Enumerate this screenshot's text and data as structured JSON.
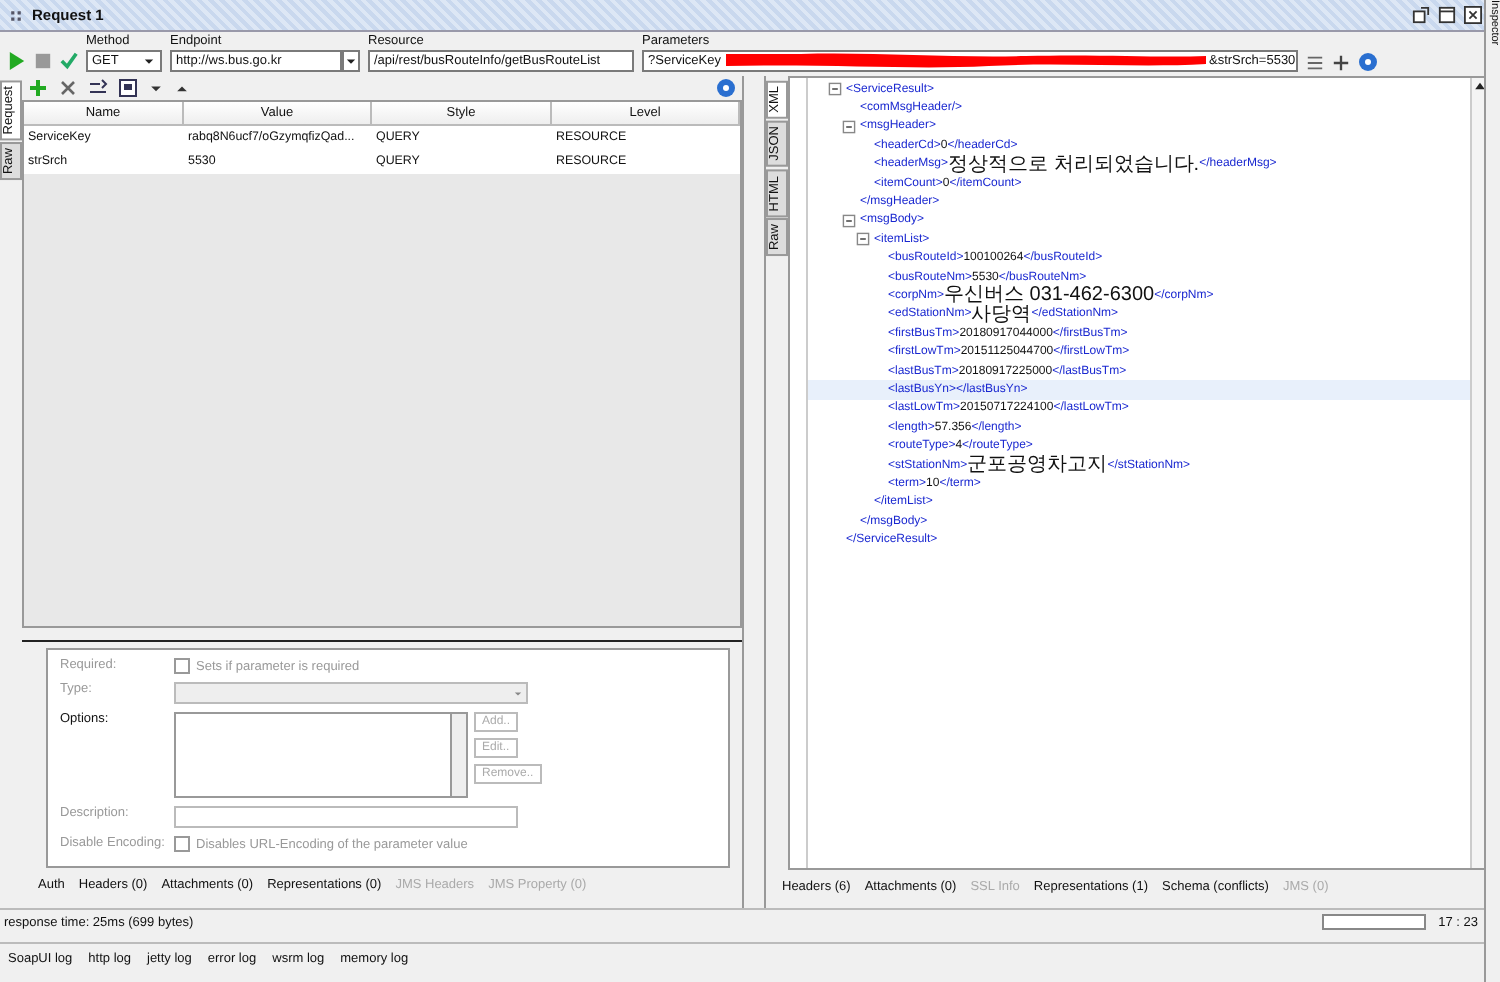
{
  "window": {
    "title": "Request 1"
  },
  "toolbar": {
    "method": {
      "label": "Method",
      "value": "GET"
    },
    "endpoint": {
      "label": "Endpoint",
      "value": "http://ws.bus.go.kr"
    },
    "resource": {
      "label": "Resource",
      "value": "/api/rest/busRouteInfo/getBusRouteList"
    },
    "parameters": {
      "label": "Parameters",
      "value_start": "?ServiceKey",
      "value_end": "&strSrch=5530"
    }
  },
  "request_tabs": [
    {
      "label": "Request",
      "selected": true
    },
    {
      "label": "Raw",
      "selected": false
    }
  ],
  "params_table": {
    "columns": [
      "Name",
      "Value",
      "Style",
      "Level"
    ],
    "rows": [
      [
        "ServiceKey",
        "rabq8N6ucf7/oGzymqfizQad...",
        "QUERY",
        "RESOURCE"
      ],
      [
        "strSrch",
        "5530",
        "QUERY",
        "RESOURCE"
      ]
    ]
  },
  "param_form": [
    {
      "kind": "checkbox",
      "label": "Required:",
      "text": "Sets if parameter is required",
      "checked": false,
      "disabled": true
    },
    {
      "kind": "select",
      "label": "Type:",
      "disabled": true
    },
    {
      "kind": "list",
      "label": "Options:",
      "disabled": false,
      "buttons": [
        "Add..",
        "Edit..",
        "Remove.."
      ]
    },
    {
      "kind": "text",
      "label": "Description:",
      "disabled": true
    },
    {
      "kind": "checkbox",
      "label": "Disable Encoding:",
      "text": "Disables URL-Encoding of the parameter value",
      "checked": false,
      "disabled": true
    }
  ],
  "request_bottom_tabs": [
    {
      "label": "Auth",
      "disabled": false
    },
    {
      "label": "Headers (0)",
      "disabled": false
    },
    {
      "label": "Attachments (0)",
      "disabled": false
    },
    {
      "label": "Representations (0)",
      "disabled": false
    },
    {
      "label": "JMS Headers",
      "disabled": true
    },
    {
      "label": "JMS Property (0)",
      "disabled": true
    }
  ],
  "response_tabs": [
    {
      "label": "XML",
      "selected": true
    },
    {
      "label": "JSON",
      "selected": false
    },
    {
      "label": "HTML",
      "selected": false
    },
    {
      "label": "Raw",
      "selected": false
    }
  ],
  "xml": {
    "open": "<ServiceResult>",
    "close": "</ServiceResult>",
    "selected": false,
    "children": [
      {
        "empty": "<comMsgHeader/>",
        "selected": false
      },
      {
        "open": "<msgHeader>",
        "close": "</msgHeader>",
        "selected": false,
        "children": [
          {
            "start": "<headerCd>",
            "value": "0",
            "end": "</headerCd>",
            "selected": false
          },
          {
            "start": "<headerMsg>",
            "value": "정상적으로 처리되었습니다.",
            "end": "</headerMsg>",
            "selected": false
          },
          {
            "start": "<itemCount>",
            "value": "0",
            "end": "</itemCount>",
            "selected": false
          }
        ]
      },
      {
        "open": "<msgBody>",
        "close": "</msgBody>",
        "selected": false,
        "children": [
          {
            "open": "<itemList>",
            "close": "</itemList>",
            "selected": false,
            "children": [
              {
                "start": "<busRouteId>",
                "value": "100100264",
                "end": "</busRouteId>",
                "selected": false
              },
              {
                "start": "<busRouteNm>",
                "value": "5530",
                "end": "</busRouteNm>",
                "selected": false
              },
              {
                "start": "<corpNm>",
                "value": "우신버스 031-462-6300",
                "end": "</corpNm>",
                "selected": false
              },
              {
                "start": "<edStationNm>",
                "value": "사당역",
                "end": "</edStationNm>",
                "selected": false
              },
              {
                "start": "<firstBusTm>",
                "value": "20180917044000",
                "end": "</firstBusTm>",
                "selected": false
              },
              {
                "start": "<firstLowTm>",
                "value": "20151125044700",
                "end": "</firstLowTm>",
                "selected": false
              },
              {
                "start": "<lastBusTm>",
                "value": "20180917225000",
                "end": "</lastBusTm>",
                "selected": false
              },
              {
                "start": "<lastBusYn>",
                "end": "</lastBusYn>",
                "selected": true
              },
              {
                "start": "<lastLowTm>",
                "value": "20150717224100",
                "end": "</lastLowTm>",
                "selected": false
              },
              {
                "start": "<length>",
                "value": "57.356",
                "end": "</length>",
                "selected": false
              },
              {
                "start": "<routeType>",
                "value": "4",
                "end": "</routeType>",
                "selected": false
              },
              {
                "start": "<stStationNm>",
                "value": "군포공영차고지",
                "end": "</stStationNm>",
                "selected": false
              },
              {
                "start": "<term>",
                "value": "10",
                "end": "</term>",
                "selected": false
              }
            ]
          }
        ]
      }
    ]
  },
  "response_bottom_tabs": [
    {
      "label": "Headers (6)",
      "disabled": false
    },
    {
      "label": "Attachments (0)",
      "disabled": false
    },
    {
      "label": "SSL Info",
      "disabled": true
    },
    {
      "label": "Representations (1)",
      "disabled": false
    },
    {
      "label": "Schema (conflicts)",
      "disabled": false
    },
    {
      "label": "JMS (0)",
      "disabled": true
    }
  ],
  "status": {
    "response_time": "response time: 25ms (699 bytes)",
    "progress": {
      "level": 0
    },
    "cursor": "17 : 23"
  },
  "log_tabs": [
    "SoapUI log",
    "http log",
    "jetty log",
    "error log",
    "wsrm log",
    "memory log"
  ],
  "side_panel": {
    "title": "Inspector"
  }
}
